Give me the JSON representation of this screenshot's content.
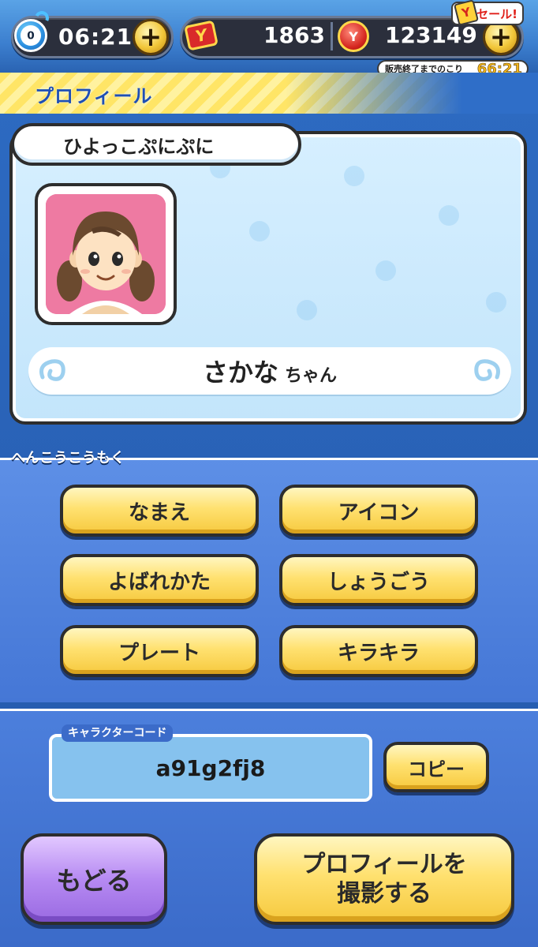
{
  "topbar": {
    "stamina_level": "0",
    "stamina_time": "06:21",
    "tickets": "1863",
    "coins": "123149",
    "sale_label": "セール!",
    "countdown_label": "販売終了までのこり",
    "countdown_value": "66:21",
    "plus": "+",
    "ticket_glyph": "Y",
    "coin_glyph": "Y"
  },
  "header": {
    "title": "プロフィール"
  },
  "profile": {
    "title_name": "ひよっこぷにぷに",
    "player_name": "さかな",
    "honorific": "ちゃん"
  },
  "edit": {
    "section_label": "へんこうこうもく",
    "buttons": [
      "なまえ",
      "アイコン",
      "よばれかた",
      "しょうごう",
      "プレート",
      "キラキラ"
    ]
  },
  "code": {
    "label": "キャラクターコード",
    "value": "a91g2fj8",
    "copy_label": "コピー"
  },
  "footer": {
    "back_label": "もどる",
    "photo_line1": "プロフィールを",
    "photo_line2": "撮影する"
  },
  "colors": {
    "accent_yellow": "#ffe170",
    "accent_purple": "#b68af2",
    "panel_blue": "#4577d6",
    "card_blue": "#c3e5fb"
  }
}
